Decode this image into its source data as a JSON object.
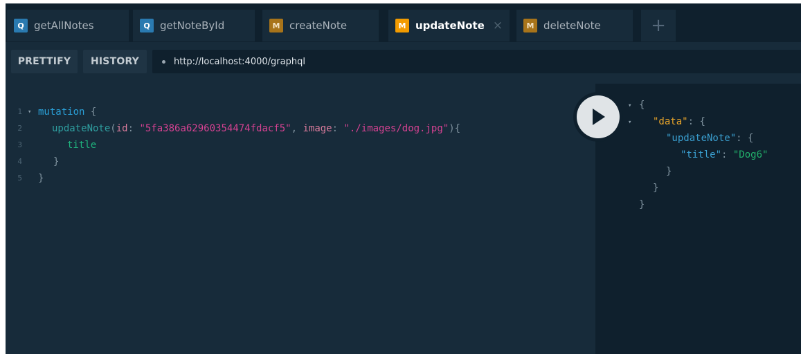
{
  "tabs": [
    {
      "badge": "Q",
      "label": "getAllNotes"
    },
    {
      "badge": "Q",
      "label": "getNoteById"
    },
    {
      "badge": "M",
      "label": "createNote"
    },
    {
      "badge": "M",
      "label": "updateNote",
      "close": "×"
    },
    {
      "badge": "M",
      "label": "deleteNote"
    },
    {
      "label": "+"
    }
  ],
  "toolbar": {
    "prettify_label": "PRETTIFY",
    "history_label": "HISTORY",
    "url": "http://localhost:4000/graphql"
  },
  "editor": {
    "line_numbers": [
      "1",
      "2",
      "3",
      "4",
      "5"
    ],
    "line1": {
      "keyword": "mutation",
      "brace": "{"
    },
    "line2": {
      "fn": "updateNote",
      "paren_open": "(",
      "arg1": "id",
      "colon1": ": ",
      "val1": "\"5fa386a62960354474fdacf5\"",
      "comma": ", ",
      "arg2": "image",
      "colon2": ": ",
      "val2": "\"./images/dog.jpg\"",
      "paren_close": "){"
    },
    "line3": {
      "field": "title"
    },
    "line4": {
      "brace": "}"
    },
    "line5": {
      "brace": "}"
    }
  },
  "result": {
    "open_brace": "{",
    "data_key": "\"data\"",
    "colon": ": ",
    "brace": "{",
    "update_key": "\"updateNote\"",
    "title_key": "\"title\"",
    "title_val": "\"Dog6\"",
    "close_brace": "}"
  },
  "icons": {
    "play": "play-icon",
    "fold": "fold-arrow-icon"
  }
}
